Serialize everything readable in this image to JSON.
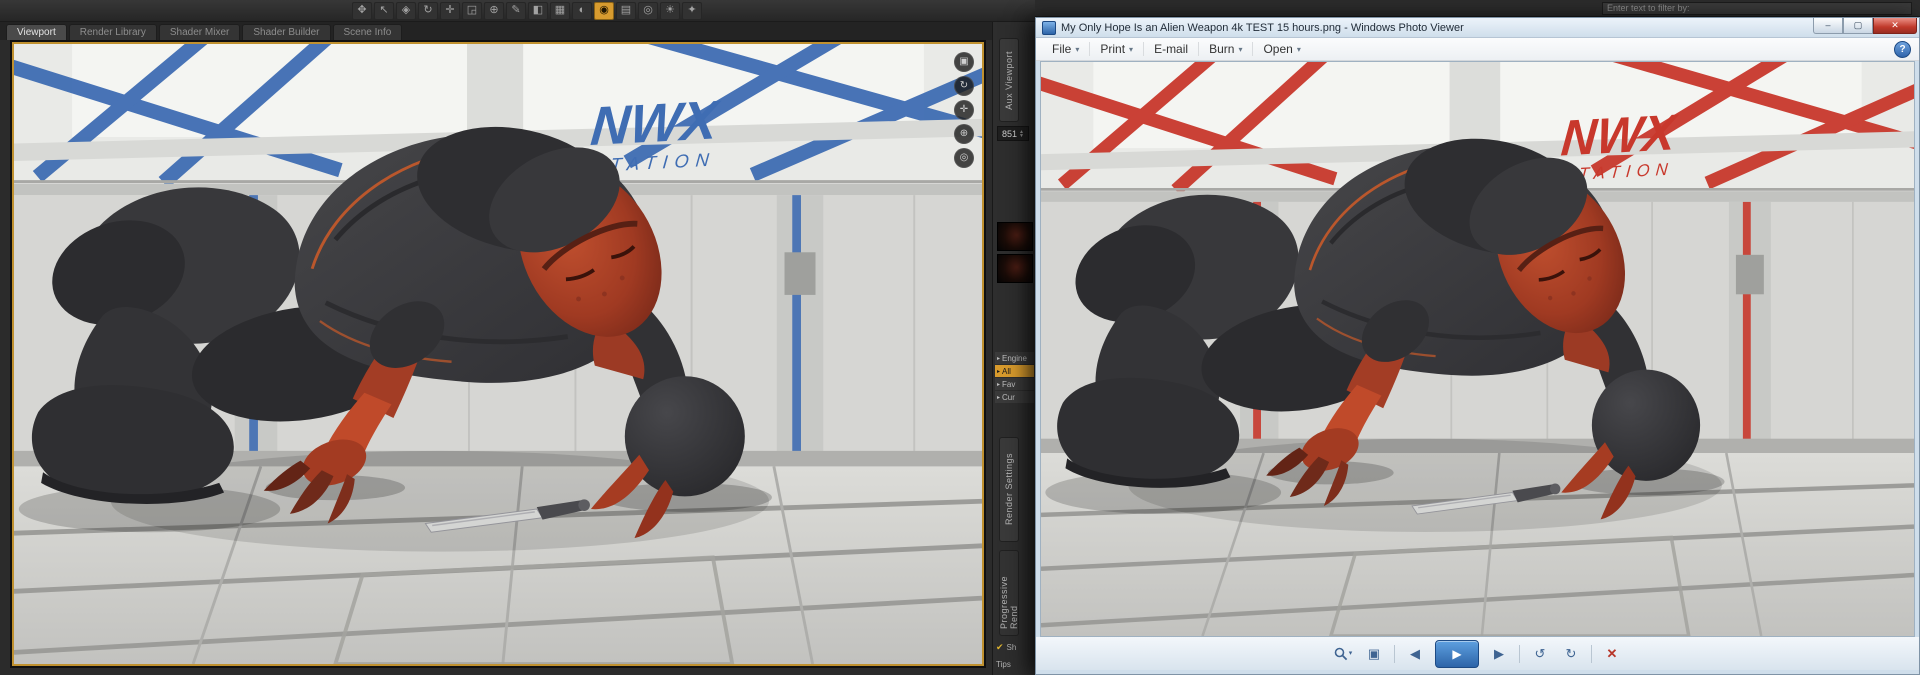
{
  "left_app": {
    "tabs": [
      {
        "label": "Viewport",
        "active": true
      },
      {
        "label": "Render Library",
        "active": false
      },
      {
        "label": "Shader Mixer",
        "active": false
      },
      {
        "label": "Shader Builder",
        "active": false
      },
      {
        "label": "Scene Info",
        "active": false
      }
    ],
    "toolbar_icons": [
      {
        "name": "scene-navigator-tool",
        "glyph": "✥"
      },
      {
        "name": "node-selection-tool",
        "glyph": "↖"
      },
      {
        "name": "geometry-selection-tool",
        "glyph": "◈"
      },
      {
        "name": "rotate-tool",
        "glyph": "↻"
      },
      {
        "name": "translate-tool",
        "glyph": "✛"
      },
      {
        "name": "scale-tool",
        "glyph": "◲"
      },
      {
        "name": "universal-manipulator-tool",
        "glyph": "⊕"
      },
      {
        "name": "posing-tool",
        "glyph": "✎"
      },
      {
        "name": "surface-selection-tool",
        "glyph": "◧"
      },
      {
        "name": "region-editor-tool",
        "glyph": "▦"
      },
      {
        "name": "spot-render-tool",
        "glyph": "◐"
      },
      {
        "name": "render-button",
        "glyph": "◉"
      },
      {
        "name": "aux-viewport-button",
        "glyph": "▤"
      },
      {
        "name": "camera-tool",
        "glyph": "◎"
      },
      {
        "name": "light-tool",
        "glyph": "☀"
      },
      {
        "name": "settings-button",
        "glyph": "✦"
      }
    ],
    "view_controls": [
      {
        "name": "cube-view-control",
        "glyph": "▣"
      },
      {
        "name": "orbit-view-control",
        "glyph": "↻"
      },
      {
        "name": "pan-view-control",
        "glyph": "✛"
      },
      {
        "name": "zoom-view-control",
        "glyph": "⊕"
      },
      {
        "name": "frame-view-control",
        "glyph": "◎"
      }
    ],
    "side_panel": {
      "aux_tab": "Aux Viewport",
      "value": "851",
      "list": [
        {
          "label": "Engine",
          "active": false
        },
        {
          "label": "All",
          "active": true
        },
        {
          "label": "Fav",
          "active": false
        },
        {
          "label": "Cur",
          "active": false
        }
      ],
      "render_settings_tab": "Render Settings",
      "progressive_tab": "Progressive Rend",
      "show_label": "Sh",
      "tips_label": "Tips"
    }
  },
  "filter_bar": {
    "placeholder": "Enter text to filter by:"
  },
  "photo_viewer": {
    "title": "My Only Hope Is an Alien Weapon 4k TEST 15 hours.png - Windows Photo Viewer",
    "menu_items": [
      {
        "label": "File",
        "arrow": true
      },
      {
        "label": "Print",
        "arrow": true
      },
      {
        "label": "E-mail",
        "arrow": false
      },
      {
        "label": "Burn",
        "arrow": true
      },
      {
        "label": "Open",
        "arrow": true
      }
    ],
    "menu_arrow": "▾",
    "help_label": "?",
    "window_buttons": [
      {
        "name": "minimize",
        "glyph": "–"
      },
      {
        "name": "maximize",
        "glyph": "▢"
      },
      {
        "name": "close",
        "glyph": "✕"
      }
    ],
    "controls": {
      "zoom_arrow": "▾",
      "actual_size": "▣",
      "prev": "◀",
      "play": "▶",
      "next": "▶",
      "rotate_ccw": "↺",
      "rotate_cw": "↻",
      "delete": "✕"
    }
  },
  "scene": {
    "logo_line1": "NWX",
    "logo_line2": "STATION",
    "accent_left": "#3f6db3",
    "accent_right": "#c8382c",
    "hazard_color": "#d6b23a",
    "creature_skin": "#a33d25",
    "creature_armor": "#3a3a3d"
  }
}
